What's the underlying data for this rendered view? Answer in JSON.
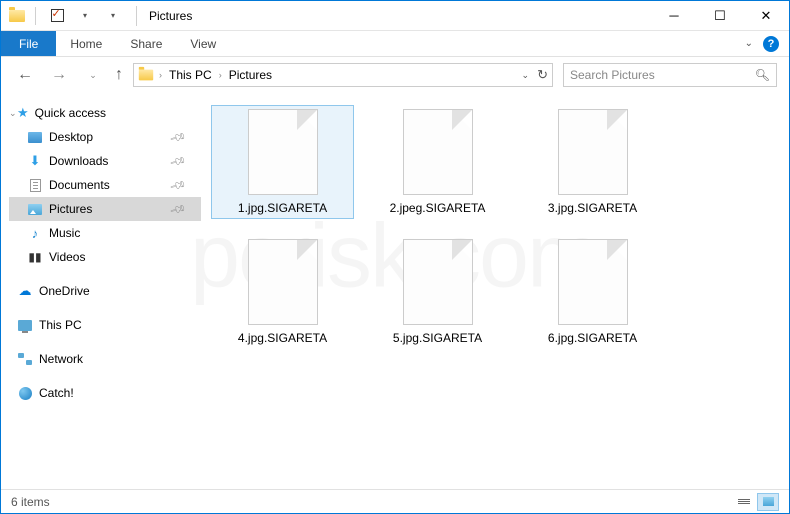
{
  "window": {
    "title": "Pictures"
  },
  "ribbon": {
    "file": "File",
    "tabs": [
      "Home",
      "Share",
      "View"
    ]
  },
  "breadcrumbs": [
    "This PC",
    "Pictures"
  ],
  "search": {
    "placeholder": "Search Pictures"
  },
  "sidebar": {
    "quick_access": "Quick access",
    "items": [
      {
        "label": "Desktop",
        "pinned": true
      },
      {
        "label": "Downloads",
        "pinned": true
      },
      {
        "label": "Documents",
        "pinned": true
      },
      {
        "label": "Pictures",
        "pinned": true,
        "selected": true
      },
      {
        "label": "Music",
        "pinned": false
      },
      {
        "label": "Videos",
        "pinned": false
      }
    ],
    "onedrive": "OneDrive",
    "thispc": "This PC",
    "network": "Network",
    "catch": "Catch!"
  },
  "files": [
    {
      "name": "1.jpg.SIGARETA",
      "selected": true
    },
    {
      "name": "2.jpeg.SIGARETA"
    },
    {
      "name": "3.jpg.SIGARETA"
    },
    {
      "name": "4.jpg.SIGARETA"
    },
    {
      "name": "5.jpg.SIGARETA"
    },
    {
      "name": "6.jpg.SIGARETA"
    }
  ],
  "status": {
    "count": "6 items"
  }
}
